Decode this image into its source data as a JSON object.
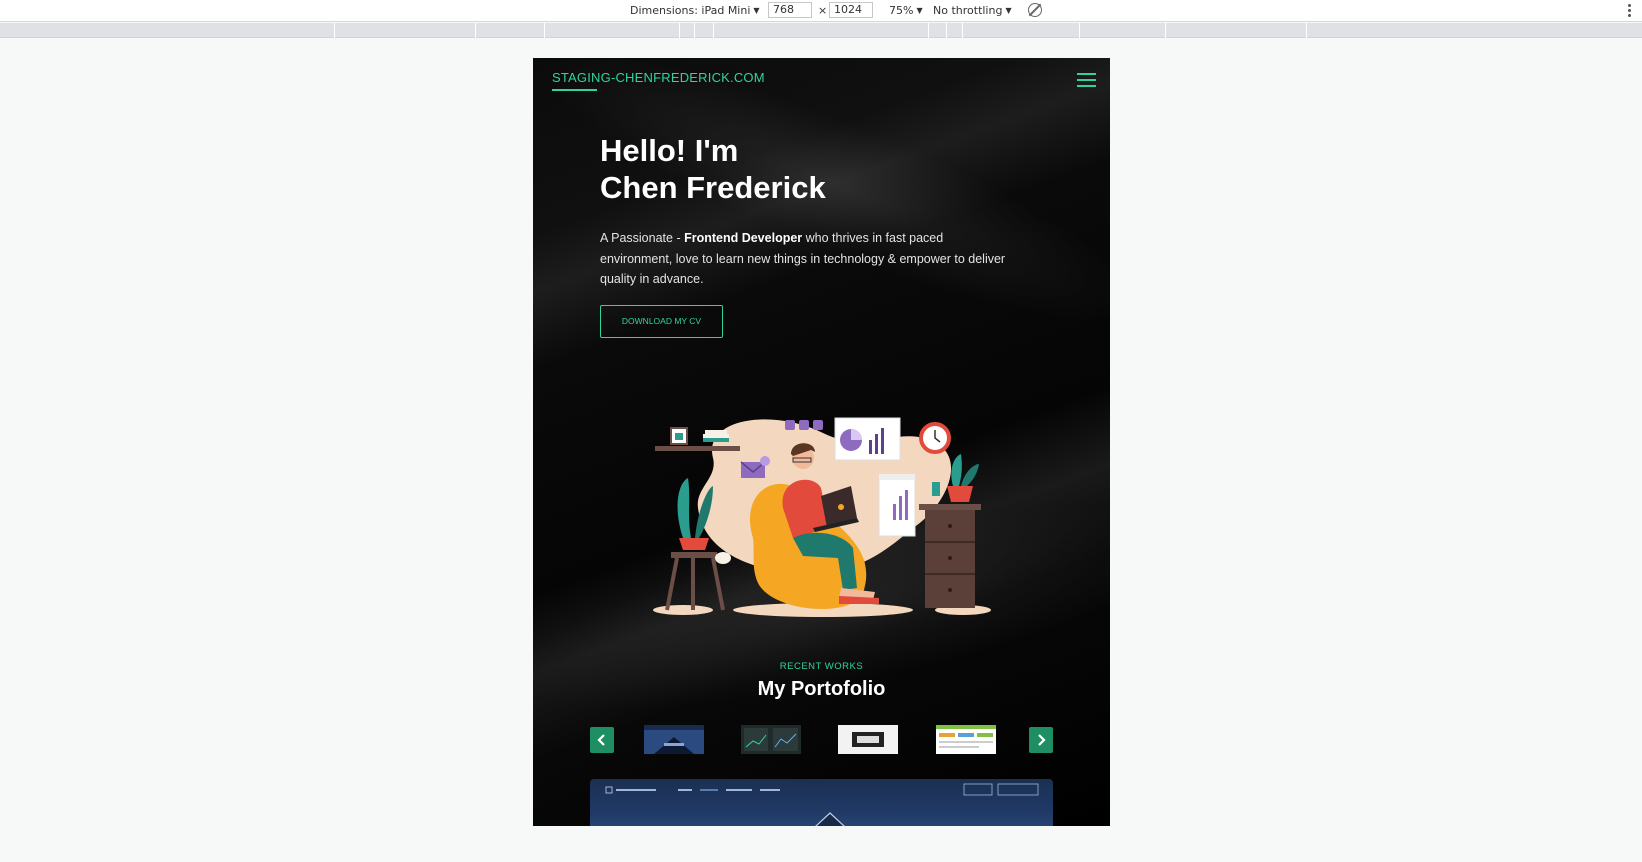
{
  "devtools": {
    "dimensions_label": "Dimensions: iPad Mini",
    "width_value": "768",
    "times": "×",
    "height_value": "1024",
    "zoom": "75%",
    "throttling": "No throttling"
  },
  "site": {
    "brand": "STAGING-CHENFREDERICK.COM",
    "hero": {
      "title_line1": "Hello! I'm",
      "title_line2": "Chen Frederick",
      "desc_prefix": "A Passionate - ",
      "desc_bold": "Frontend Developer",
      "desc_suffix": " who thrives in fast paced environment, love to learn new things in technology & empower to deliver quality in advance.",
      "cta": "DOWNLOAD MY CV"
    },
    "portfolio": {
      "subtitle": "RECENT WORKS",
      "title": "My Portofolio"
    }
  },
  "colors": {
    "accent": "#2fd3a0",
    "arrow_bg": "#1f8f63"
  },
  "icons": [
    "hamburger-menu-icon",
    "chevron-left-icon",
    "chevron-right-icon",
    "rotate-icon",
    "more-vert-icon"
  ]
}
